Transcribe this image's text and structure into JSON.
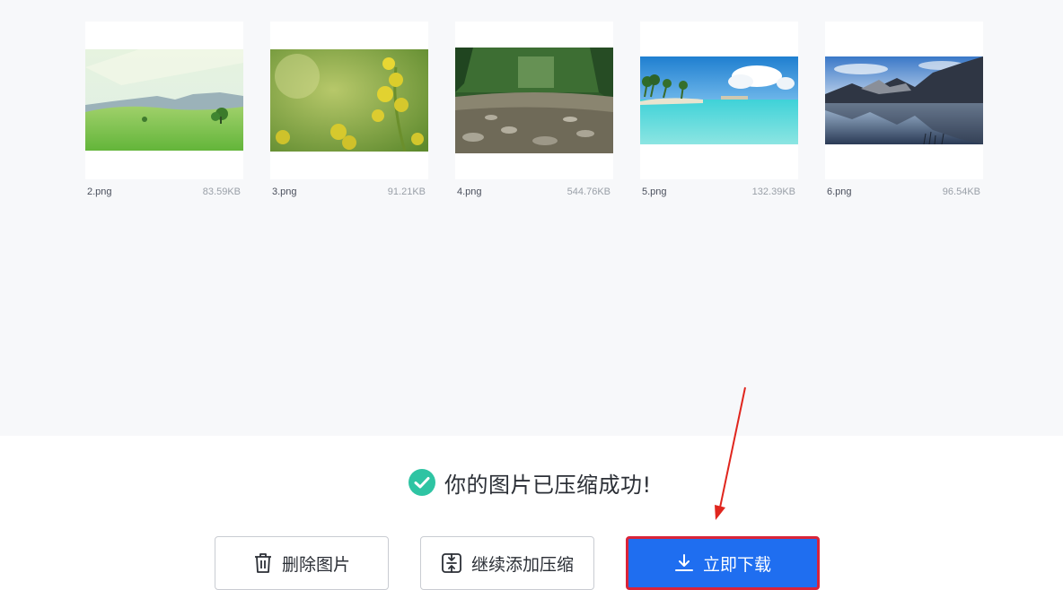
{
  "files": [
    {
      "name": "2.png",
      "size": "83.59KB"
    },
    {
      "name": "3.png",
      "size": "91.21KB"
    },
    {
      "name": "4.png",
      "size": "544.76KB"
    },
    {
      "name": "5.png",
      "size": "132.39KB"
    },
    {
      "name": "6.png",
      "size": "96.54KB"
    }
  ],
  "status": {
    "message": "你的图片已压缩成功!",
    "icon": "check-circle-icon",
    "icon_color": "#2ec4a3"
  },
  "actions": {
    "delete_label": "删除图片",
    "continue_label": "继续添加压缩",
    "download_label": "立即下载"
  },
  "colors": {
    "primary": "#1f6ef0",
    "highlight_border": "#d9243a",
    "annotation_arrow": "#e0261e"
  }
}
